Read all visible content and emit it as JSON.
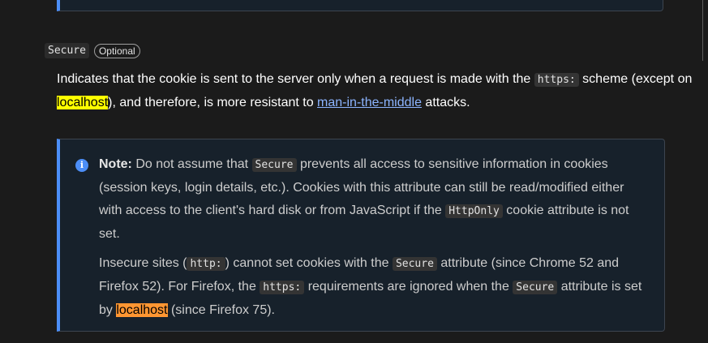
{
  "section": {
    "term": "Secure",
    "badge": "Optional"
  },
  "description": {
    "part1": "Indicates that the cookie is sent to the server only when a request is made with the ",
    "code_https": "https:",
    "part2": " scheme (except on ",
    "highlight_localhost": "localhost",
    "part3": "), and therefore, is more resistant to ",
    "link_text": "man-in-the-middle",
    "part4": " attacks."
  },
  "note": {
    "icon": "info-icon",
    "label": "Note:",
    "p1_part1": " Do not assume that ",
    "p1_code_secure": "Secure",
    "p1_part2": " prevents all access to sensitive information in cookies (session keys, login details, etc.). Cookies with this attribute can still be read/modified either with access to the client's hard disk or from JavaScript if the ",
    "p1_code_httponly": "HttpOnly",
    "p1_part3": " cookie attribute is not set.",
    "p2_part1": "Insecure sites (",
    "p2_code_http": "http:",
    "p2_part2": ") cannot set cookies with the ",
    "p2_code_secure": "Secure",
    "p2_part3": " attribute (since Chrome 52 and Firefox 52). For Firefox, the ",
    "p2_code_https": "https:",
    "p2_part4": " requirements are ignored when the ",
    "p2_code_secure2": "Secure",
    "p2_part5": " attribute is set by ",
    "p2_highlight_localhost": "localhost",
    "p2_part6": " (since Firefox 75)."
  },
  "colors": {
    "background": "#1b1b1b",
    "note_background": "#17212b",
    "note_accent": "#4c8ef7",
    "find_highlight": "#ffff00",
    "find_highlight_active": "#ff9632",
    "link": "#8cb4ff"
  }
}
